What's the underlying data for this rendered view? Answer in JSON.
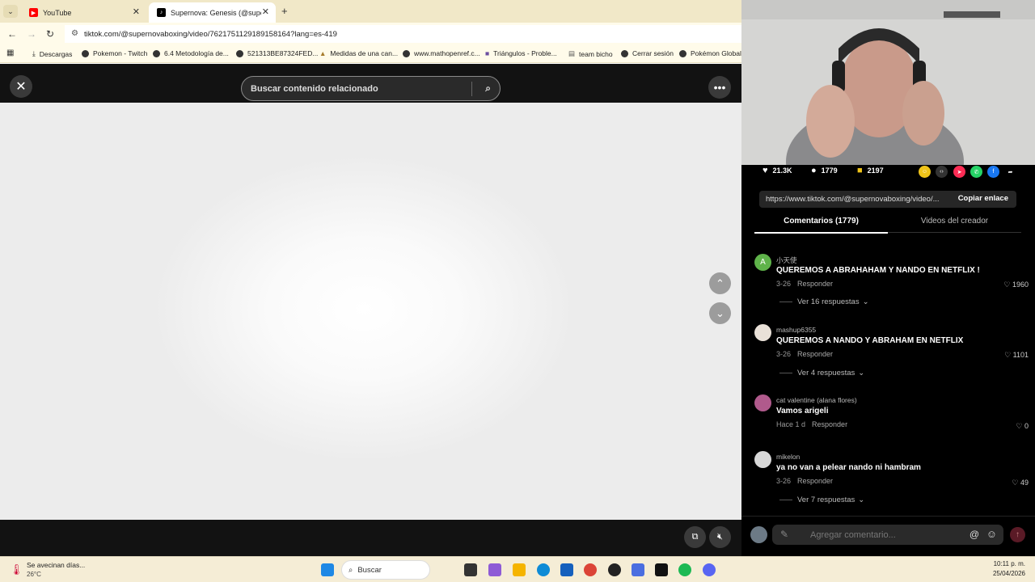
{
  "browser": {
    "tabs": [
      {
        "title": "YouTube",
        "active": false,
        "favicon_color": "#ff0000"
      },
      {
        "title": "Supernova: Genesis (@superno",
        "active": true,
        "favicon_color": "#000000"
      }
    ],
    "new_tab_glyph": "+",
    "url": "tiktok.com/@supernovaboxing/video/7621751129189158164?lang=es-419",
    "bookmarks": [
      "Descargas",
      "Pokemon - Twitch",
      "6.4 Metodología de...",
      "521313BE87324FED...",
      "Medidas de una can...",
      "www.mathopenref.c...",
      "Triángulos - Proble...",
      "team bicho",
      "Cerrar sesión",
      "Pokémon Global L"
    ]
  },
  "video_view": {
    "search_placeholder": "Buscar contenido relacionado",
    "close_icon": "close-icon",
    "more_icon": "more-horizontal-icon"
  },
  "side": {
    "stats": {
      "likes": "21.3K",
      "comments": "1779",
      "saves": "2197"
    },
    "share_colors": [
      "#f0c419",
      "#333333",
      "#fe2c55",
      "#25d366",
      "#1877f2",
      "#000000"
    ],
    "link": "https://www.tiktok.com/@supernovaboxing/video/...",
    "copy_label": "Copiar enlace",
    "tabs": [
      "Comentarios (1779)",
      "Videos del creador"
    ],
    "comments": [
      {
        "user": "小天使",
        "text": "QUEREMOS A ABRAHAHAM Y NANDO EN NETFLIX !",
        "date": "3-26",
        "reply": "Responder",
        "likes": "1960",
        "replies": "Ver 16 respuestas",
        "avatar_letter": "A",
        "avatar_color": "#5fb34a"
      },
      {
        "user": "mashup6355",
        "text": "QUEREMOS A NANDO Y ABRAHAM EN NETFLIX",
        "date": "3-26",
        "reply": "Responder",
        "likes": "1101",
        "replies": "Ver 4 respuestas",
        "avatar_letter": "",
        "avatar_color": "#e9e1d8"
      },
      {
        "user": "cat valentine (alana flores)",
        "text": "Vamos arigeli",
        "date": "Hace 1 d",
        "reply": "Responder",
        "likes": "0",
        "replies": "",
        "avatar_letter": "",
        "avatar_color": "#b05a8c"
      },
      {
        "user": "mikelon",
        "text": "ya no van a pelear nando ni hambram",
        "date": "3-26",
        "reply": "Responder",
        "likes": "49",
        "replies": "Ver 7 respuestas",
        "avatar_letter": "",
        "avatar_color": "#d8d8d8"
      }
    ],
    "comment_placeholder": "Agregar comentario..."
  },
  "taskbar": {
    "weather_title": "Se avecinan días...",
    "weather_temp": "26°C",
    "search_label": "Buscar",
    "time": "10:11 p. m.",
    "date": "25/04/2026"
  }
}
